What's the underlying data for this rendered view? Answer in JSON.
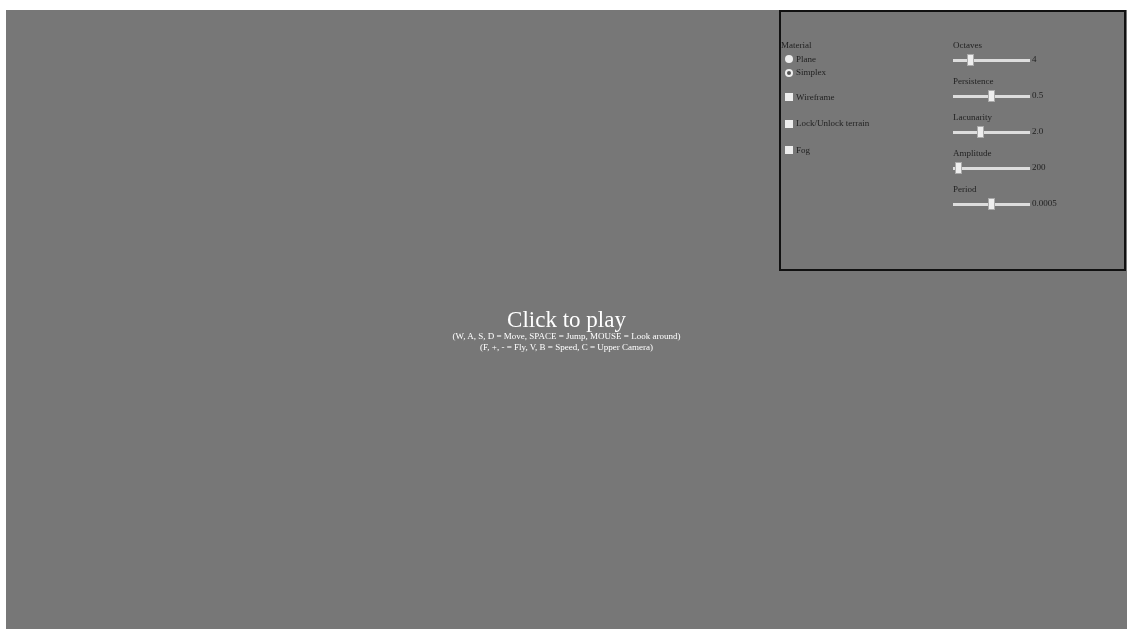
{
  "controls": {
    "material": {
      "label": "Material",
      "options": [
        {
          "label": "Plane",
          "selected": false
        },
        {
          "label": "Simplex",
          "selected": true
        }
      ]
    },
    "checkboxes": [
      {
        "label": "Wireframe",
        "checked": false
      },
      {
        "label": "Lock/Unlock terrain",
        "checked": false
      },
      {
        "label": "Fog",
        "checked": false
      }
    ],
    "sliders": [
      {
        "label": "Octaves",
        "level": 0.22,
        "reading": "4"
      },
      {
        "label": "Persistence",
        "level": 0.5,
        "reading": "0.5"
      },
      {
        "label": "Lacunarity",
        "level": 0.35,
        "reading": "2.0"
      },
      {
        "label": "Amplitude",
        "level": 0.05,
        "reading": "200"
      },
      {
        "label": "Period",
        "level": 0.5,
        "reading": "0.0005"
      }
    ]
  },
  "overlay": {
    "title": "Click to play",
    "lines": [
      "(W, A, S, D = Move, SPACE = Jump, MOUSE = Look around)",
      "(F, +, - = Fly, V, B = Speed, C = Upper Camera)"
    ]
  }
}
